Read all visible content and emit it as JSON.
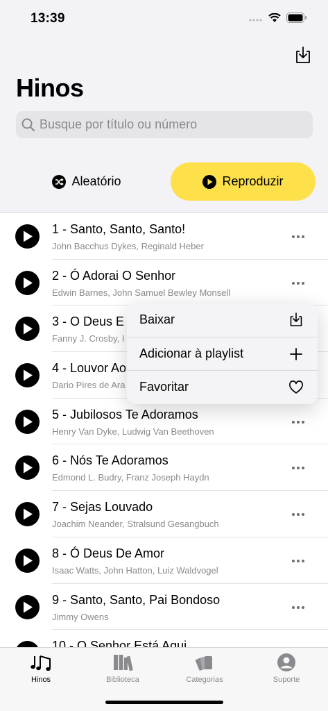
{
  "status": {
    "time": "13:39"
  },
  "header": {
    "title": "Hinos",
    "search_placeholder": "Busque por título ou número",
    "random_label": "Aleatório",
    "play_label": "Reproduzir"
  },
  "hymns": [
    {
      "title": "1 - Santo, Santo, Santo!",
      "authors": "John Bacchus Dykes, Reginald Heber"
    },
    {
      "title": "2 - Ó Adorai O Senhor",
      "authors": "Edwin Barnes, John Samuel Bewley Monsell"
    },
    {
      "title": "3 - O Deus E",
      "authors": "Fanny J. Crosby, I"
    },
    {
      "title": "4 - Louvor Ao",
      "authors": "Dario Pires de Ara"
    },
    {
      "title": "5 - Jubilosos Te Adoramos",
      "authors": "Henry Van Dyke, Ludwig Van Beethoven"
    },
    {
      "title": "6 - Nós Te Adoramos",
      "authors": "Edmond L. Budry, Franz Joseph Haydn"
    },
    {
      "title": "7 - Sejas Louvado",
      "authors": "Joachim Neander, Stralsund Gesangbuch"
    },
    {
      "title": "8 - Ó Deus De Amor",
      "authors": "Isaac Watts, John Hatton, Luiz Waldvogel"
    },
    {
      "title": "9 - Santo, Santo, Pai Bondoso",
      "authors": "Jimmy Owens"
    },
    {
      "title": "10 - O Senhor Está Aqui",
      "authors": ""
    }
  ],
  "menu": {
    "download": "Baixar",
    "add_playlist": "Adicionar à playlist",
    "favorite": "Favoritar"
  },
  "tabs": [
    {
      "label": "Hinos",
      "icon": "music-notes-icon",
      "active": true
    },
    {
      "label": "Biblioteca",
      "icon": "library-icon",
      "active": false
    },
    {
      "label": "Categorias",
      "icon": "categories-icon",
      "active": false
    },
    {
      "label": "Suporte",
      "icon": "person-circle-icon",
      "active": false
    }
  ],
  "colors": {
    "accent": "#fde04a",
    "background": "#f2f2f7",
    "secondary_text": "#8a8a8e"
  }
}
